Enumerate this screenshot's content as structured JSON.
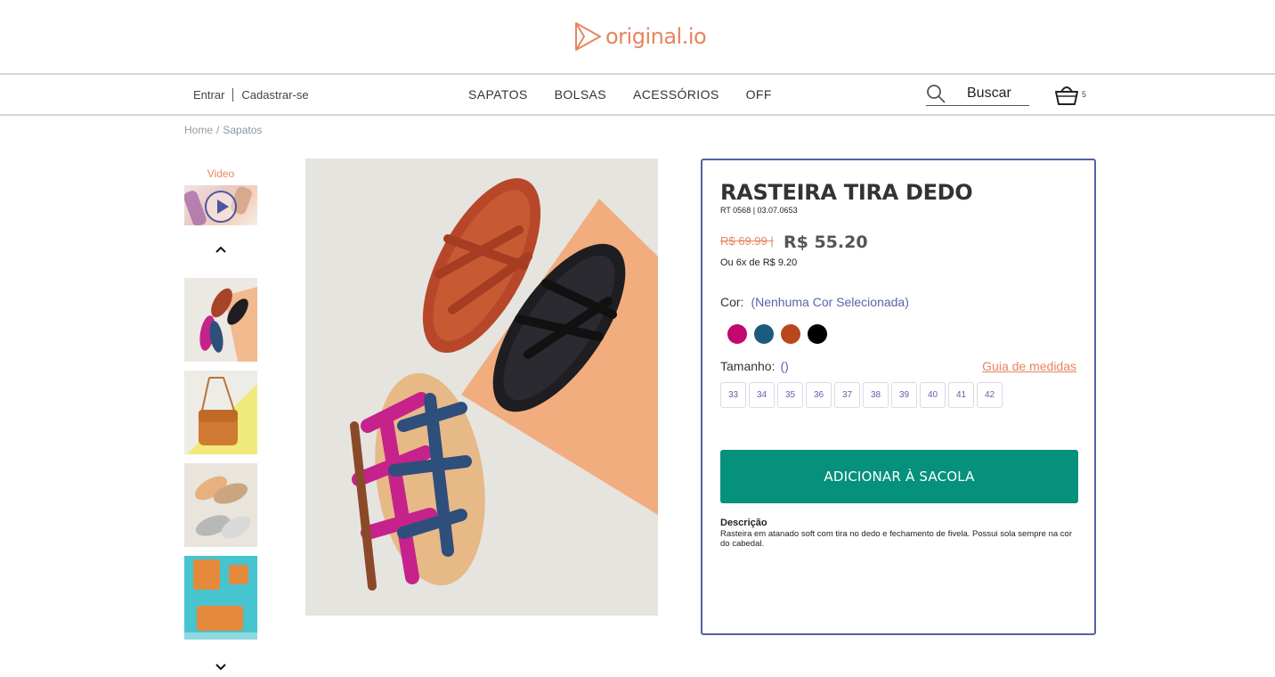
{
  "brand": {
    "logo_text": "original.io",
    "accent": "#e6855e"
  },
  "header": {
    "login": "Entrar",
    "register": "Cadastrar-se",
    "menu": [
      "SAPATOS",
      "BOLSAS",
      "ACESSÓRIOS",
      "OFF"
    ],
    "search_label": "Buscar",
    "cart_count": "5"
  },
  "breadcrumb": {
    "home": "Home",
    "separator": "/",
    "current": "Sapatos"
  },
  "gallery": {
    "video_label": "Video",
    "thumbnails": [
      "sandals",
      "bag",
      "metallic-sandals",
      "orange-bags"
    ]
  },
  "product": {
    "title": "RASTEIRA TIRA DEDO",
    "sku": "RT 0568 | 03.07.0653",
    "old_price": "R$ 69.99 |",
    "price": "R$ 55.20",
    "installments": "Ou 6x de R$ 9.20",
    "color_label": "Cor:",
    "color_selected": "(Nenhuma Cor Selecionada)",
    "colors": [
      "#c2086e",
      "#1c5b7e",
      "#b8471d",
      "#000000"
    ],
    "size_label": "Tamanho:",
    "size_selected": "()",
    "size_guide": "Guia de medidas",
    "sizes": [
      "33",
      "34",
      "35",
      "36",
      "37",
      "38",
      "39",
      "40",
      "41",
      "42"
    ],
    "add_button": "ADICIONAR À SACOLA",
    "description_title": "Descrição",
    "description": "Rasteira em atanado soft com tira no dedo e fechamento de fivela. Possui sola sempre na cor do cabedal."
  },
  "colors": {
    "panel_border": "#5561a3",
    "button": "#05917c",
    "link": "#5a64a8"
  }
}
